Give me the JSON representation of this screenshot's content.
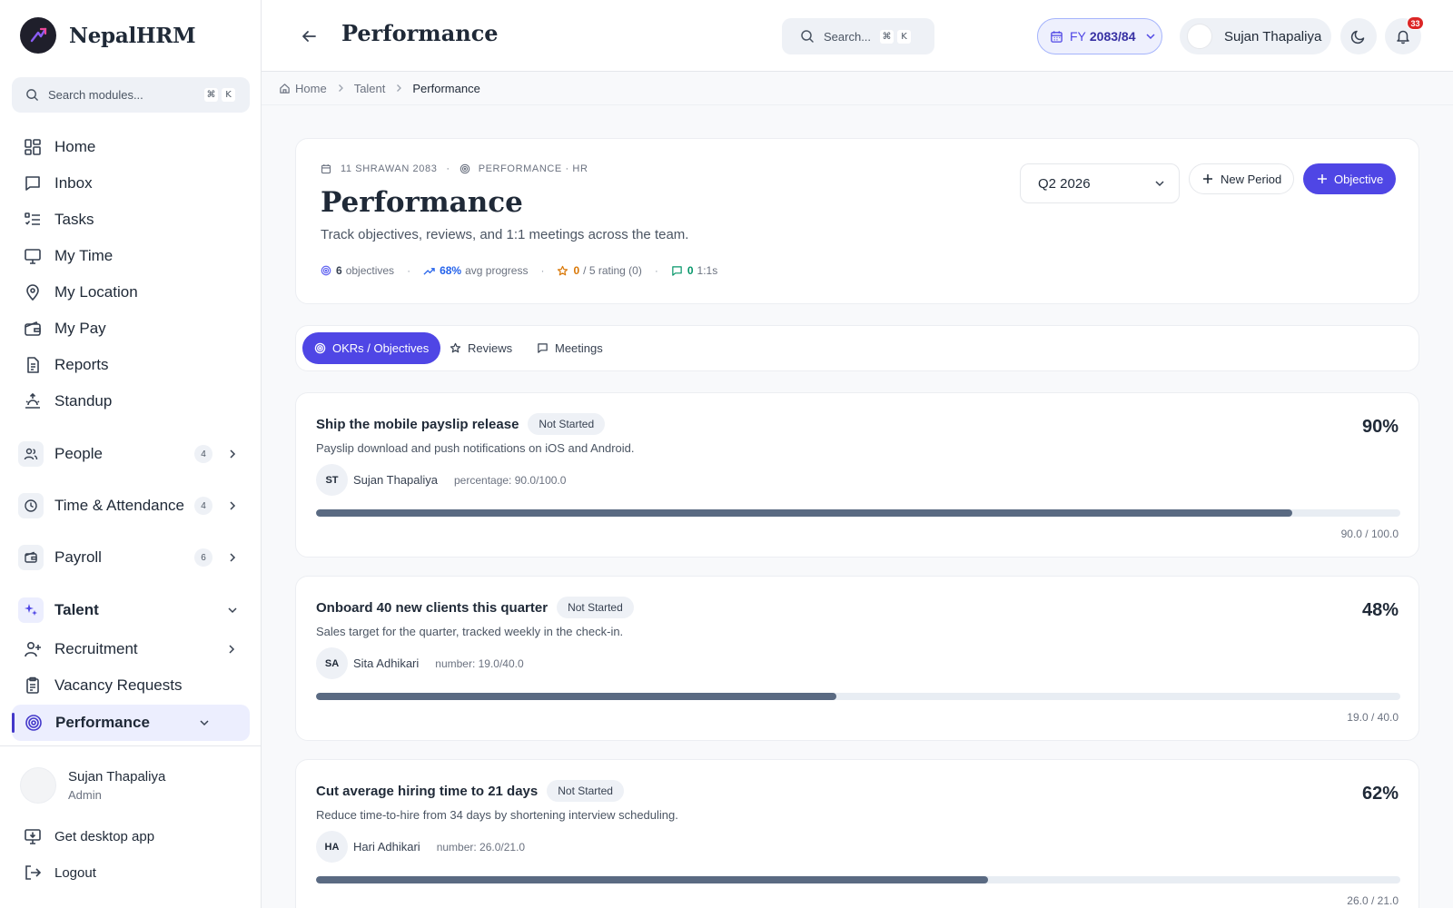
{
  "app": {
    "name": "NepalHRM"
  },
  "sidebar": {
    "search_placeholder": "Search modules...",
    "search_keys": [
      "⌘",
      "K"
    ],
    "nav": [
      {
        "label": "Home",
        "icon": "grid-icon"
      },
      {
        "label": "Inbox",
        "icon": "message-icon"
      },
      {
        "label": "Tasks",
        "icon": "list-check-icon"
      },
      {
        "label": "My Time",
        "icon": "monitor-icon"
      },
      {
        "label": "My Location",
        "icon": "map-pin-icon"
      },
      {
        "label": "My Pay",
        "icon": "wallet-icon"
      },
      {
        "label": "Reports",
        "icon": "file-text-icon"
      },
      {
        "label": "Standup",
        "icon": "sunrise-icon"
      }
    ],
    "groups": [
      {
        "label": "People",
        "count": "4",
        "icon": "users-icon"
      },
      {
        "label": "Time & Attendance",
        "count": "4",
        "icon": "clock-icon"
      },
      {
        "label": "Payroll",
        "count": "6",
        "icon": "wallet-icon"
      }
    ],
    "talent": {
      "label": "Talent",
      "icon": "sparkles-icon",
      "items": [
        {
          "label": "Recruitment",
          "icon": "user-plus-icon"
        },
        {
          "label": "Vacancy Requests",
          "icon": "clipboard-icon"
        }
      ],
      "active": {
        "label": "Performance",
        "icon": "target-icon"
      }
    },
    "user": {
      "name": "Sujan Thapaliya",
      "role": "Admin"
    },
    "footer": [
      {
        "label": "Get desktop app",
        "icon": "download-monitor-icon"
      },
      {
        "label": "Logout",
        "icon": "logout-icon"
      }
    ]
  },
  "topbar": {
    "title": "Performance",
    "search_placeholder": "Search...",
    "search_keys": [
      "⌘",
      "K"
    ],
    "fy_prefix": "FY",
    "fy_value": "2083/84",
    "user_name": "Sujan Thapaliya",
    "notifications": "33"
  },
  "breadcrumb": [
    "Home",
    "Talent",
    "Performance"
  ],
  "header": {
    "date": "11 SHRAWAN 2083",
    "context": "PERFORMANCE · HR",
    "title": "Performance",
    "subtitle": "Track objectives, reviews, and 1:1 meetings across the team.",
    "stats": {
      "objectives_value": "6",
      "objectives_label": "objectives",
      "progress_value": "68%",
      "progress_label": "avg progress",
      "rating_value": "0",
      "rating_label": "/ 5 rating (0)",
      "meetings_value": "0",
      "meetings_label": "1:1s"
    },
    "period": "Q2 2026",
    "new_period_label": "New Period",
    "objective_label": "Objective"
  },
  "tabs": [
    {
      "label": "OKRs / Objectives",
      "icon": "target-icon",
      "active": true
    },
    {
      "label": "Reviews",
      "icon": "star-icon",
      "active": false
    },
    {
      "label": "Meetings",
      "icon": "message-icon",
      "active": false
    }
  ],
  "objectives": [
    {
      "title": "Ship the mobile payslip release",
      "status": "Not Started",
      "percent": "90%",
      "progress": 0.9,
      "description": "Payslip download and push notifications on iOS and Android.",
      "initials": "ST",
      "owner": "Sujan Thapaliya",
      "metric": "percentage: 90.0/100.0",
      "progress_text": "90.0 / 100.0"
    },
    {
      "title": "Onboard 40 new clients this quarter",
      "status": "Not Started",
      "percent": "48%",
      "progress": 0.48,
      "description": "Sales target for the quarter, tracked weekly in the check-in.",
      "initials": "SA",
      "owner": "Sita Adhikari",
      "metric": "number: 19.0/40.0",
      "progress_text": "19.0 / 40.0"
    },
    {
      "title": "Cut average hiring time to 21 days",
      "status": "Not Started",
      "percent": "62%",
      "progress": 0.62,
      "description": "Reduce time-to-hire from 34 days by shortening interview scheduling.",
      "initials": "HA",
      "owner": "Hari Adhikari",
      "metric": "number: 26.0/21.0",
      "progress_text": "26.0 / 21.0"
    }
  ],
  "colors": {
    "accent": "#4f46e5",
    "progress": "#5a6a82",
    "notification": "#dc2626"
  }
}
